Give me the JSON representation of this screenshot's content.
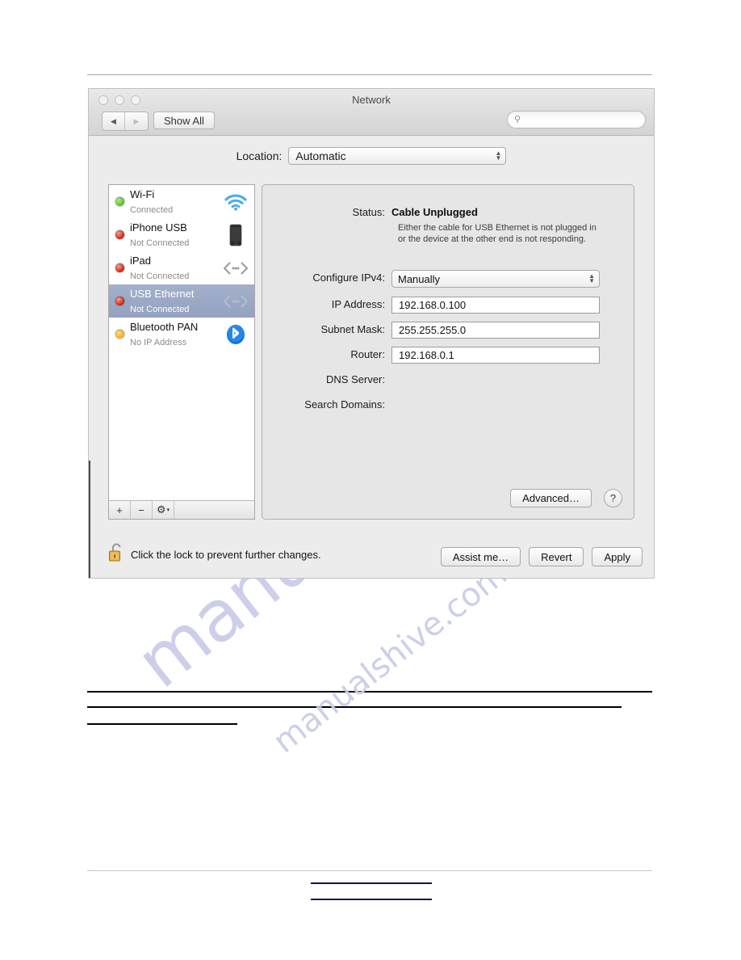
{
  "window": {
    "title": "Network",
    "traffic_lights": [
      "close",
      "minimize",
      "zoom"
    ],
    "nav": {
      "back": "◀",
      "forward": "▶"
    },
    "show_all_label": "Show All",
    "search": {
      "placeholder": "",
      "value": "",
      "icon": "search-icon"
    }
  },
  "location": {
    "label": "Location:",
    "value": "Automatic"
  },
  "sidebar": {
    "services": [
      {
        "name": "Wi‑Fi",
        "status": "Connected",
        "dot": "green",
        "icon": "wifi-icon",
        "selected": false
      },
      {
        "name": "iPhone USB",
        "status": "Not Connected",
        "dot": "red",
        "icon": "iphone-icon",
        "selected": false
      },
      {
        "name": "iPad",
        "status": "Not Connected",
        "dot": "red",
        "icon": "ethernet-icon",
        "selected": false
      },
      {
        "name": "USB Ethernet",
        "status": "Not Connected",
        "dot": "red",
        "icon": "ethernet-icon",
        "selected": true
      },
      {
        "name": "Bluetooth PAN",
        "status": "No IP Address",
        "dot": "yellow",
        "icon": "bluetooth-icon",
        "selected": false
      }
    ],
    "footer": {
      "add": "+",
      "remove": "−",
      "gear": "⚙",
      "gear_caret": "▾"
    }
  },
  "detail": {
    "status_label": "Status:",
    "status_value": "Cable Unplugged",
    "status_description": "Either the cable for USB Ethernet is not plugged in or the device at the other end is not responding.",
    "fields": [
      {
        "label": "Configure IPv4:",
        "value": "Manually",
        "type": "select"
      },
      {
        "label": "IP Address:",
        "value": "192.168.0.100",
        "type": "text"
      },
      {
        "label": "Subnet Mask:",
        "value": "255.255.255.0",
        "type": "text"
      },
      {
        "label": "Router:",
        "value": "192.168.0.1",
        "type": "text"
      },
      {
        "label": "DNS Server:",
        "value": "",
        "type": "empty"
      },
      {
        "label": "Search Domains:",
        "value": "",
        "type": "empty"
      }
    ],
    "advanced_label": "Advanced…",
    "help_label": "?"
  },
  "footer": {
    "lock_icon": "unlocked-padlock-icon",
    "lock_text": "Click the lock to prevent further changes.",
    "buttons": [
      "Assist me…",
      "Revert",
      "Apply"
    ]
  },
  "watermark": {
    "text_1": "manualshive.com",
    "text_2": "manualshive.com",
    "color": "#c9cbe9"
  },
  "colors": {
    "selection": "#99a7c5",
    "window_bg": "#ececec",
    "panel_bg": "#e6e6e6",
    "link_underline": "#131357"
  }
}
